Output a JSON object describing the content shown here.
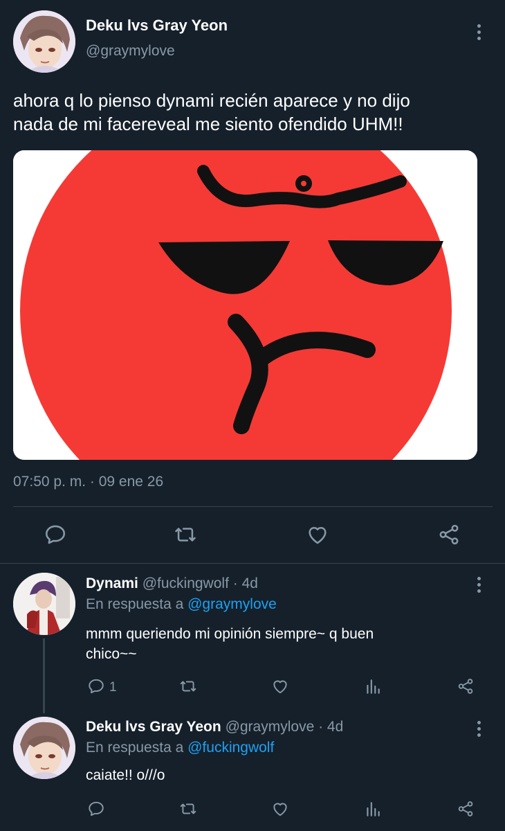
{
  "main_tweet": {
    "author_name": "Deku lvs Gray Yeon",
    "author_handle": "@graymylove",
    "text_line1": "ahora q lo pienso dynami recién aparece y no dijo",
    "text_line2": "nada de mi facereveal me siento ofendido UHM!!",
    "media_description": "red angry face emoji",
    "timestamp": "07:50 p. m. · 09 ene 26"
  },
  "reply1": {
    "author_name": "Dynami",
    "author_handle": "@fuckingwolf · 4d",
    "reply_prefix": "En respuesta a",
    "reply_to": "@graymylove",
    "text_line1": "mmm queriendo mi opinión siempre~ q buen",
    "text_line2": "chico~~",
    "reply_count": "1"
  },
  "reply2": {
    "author_name": "Deku lvs Gray Yeon",
    "author_handle": "@graymylove · 4d",
    "reply_prefix": "En respuesta a",
    "reply_to": "@fuckingwolf",
    "text": "caiate!! o///o"
  },
  "colors": {
    "background": "#15202b",
    "muted": "#8899a6",
    "link": "#1da1f2",
    "divider": "#38444d",
    "emoji_red": "#f53a35"
  },
  "icons": [
    "more-vert-icon",
    "reply-icon",
    "retweet-icon",
    "like-icon",
    "share-icon",
    "analytics-icon"
  ]
}
